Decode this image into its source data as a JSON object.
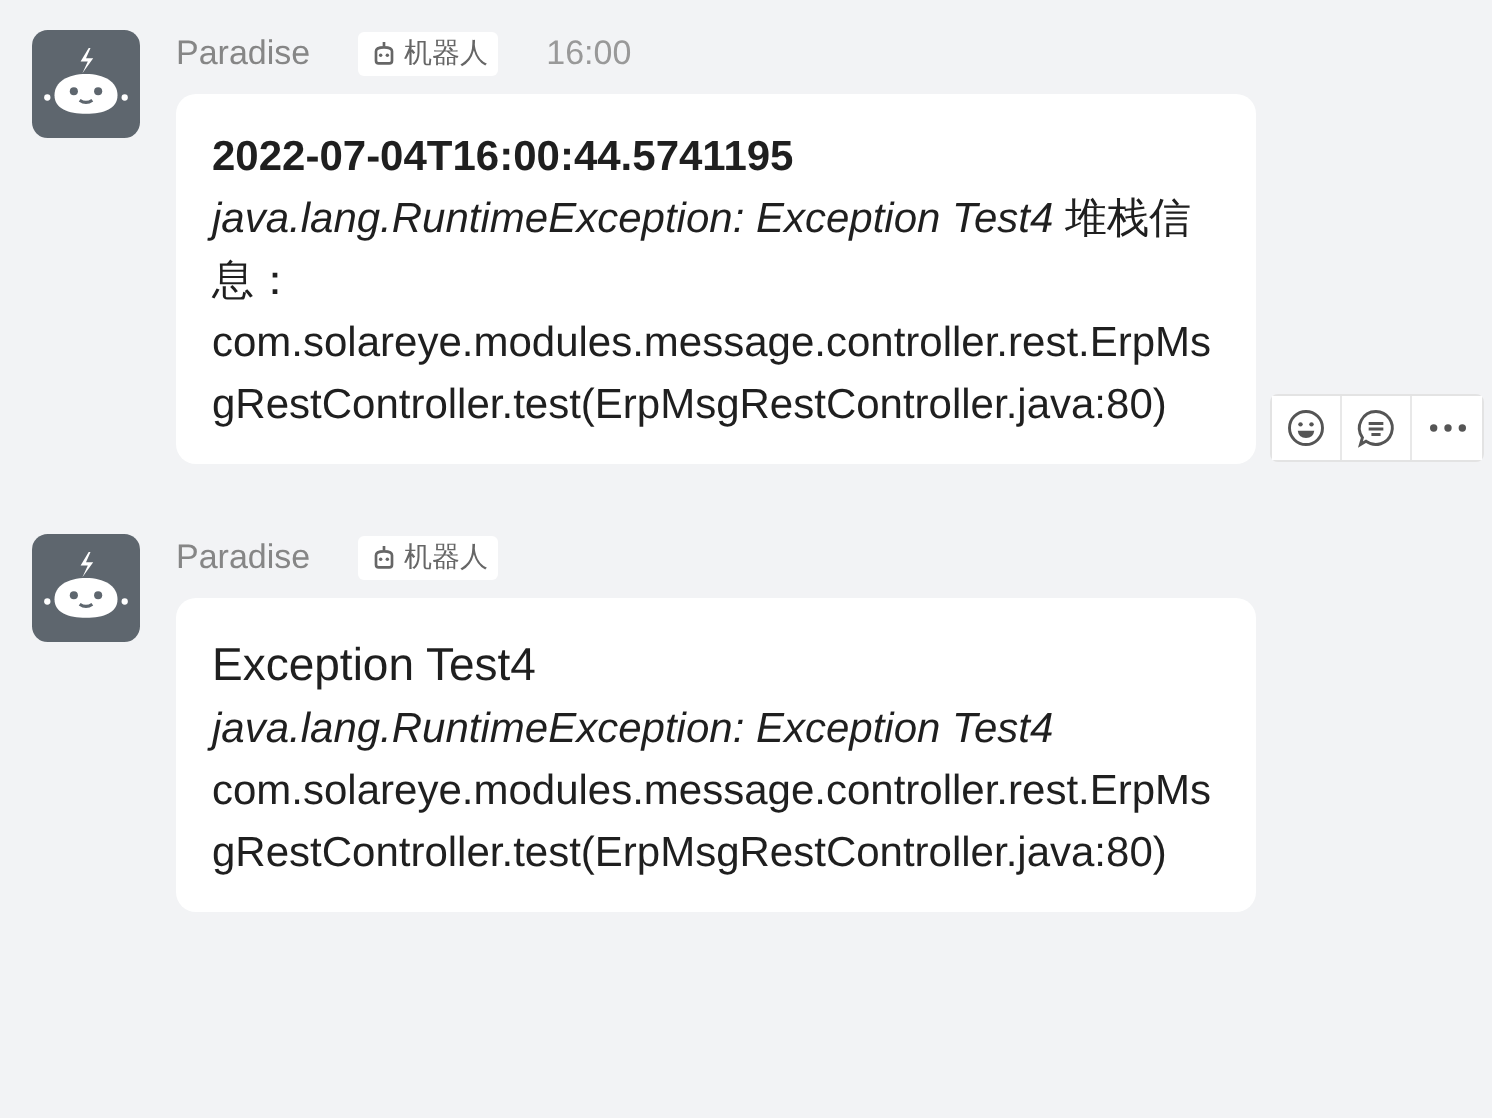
{
  "messages": [
    {
      "sender": "Paradise",
      "badge": "机器人",
      "time": "16:00",
      "hover_actions": true,
      "lines": [
        {
          "kind": "bold",
          "text": "2022-07-04T16:00:44.5741195"
        },
        {
          "kind": "plain",
          "text": "*java.lang.RuntimeException: Exception Test4* 堆栈信息："
        },
        {
          "kind": "plain",
          "text": "com.solareye.modules.message.controller.rest.ErpMsgRestController.test(ErpMsgRestController.java:80)"
        }
      ]
    },
    {
      "sender": "Paradise",
      "badge": "机器人",
      "hover_actions": false,
      "lines": [
        {
          "kind": "title",
          "text": "Exception Test4"
        },
        {
          "kind": "italic",
          "text": "java.lang.RuntimeException: Exception Test4"
        },
        {
          "kind": "plain",
          "text": "com.solareye.modules.message.controller.rest.ErpMsgRestController.test(ErpMsgRestController.java:80)"
        }
      ]
    }
  ]
}
